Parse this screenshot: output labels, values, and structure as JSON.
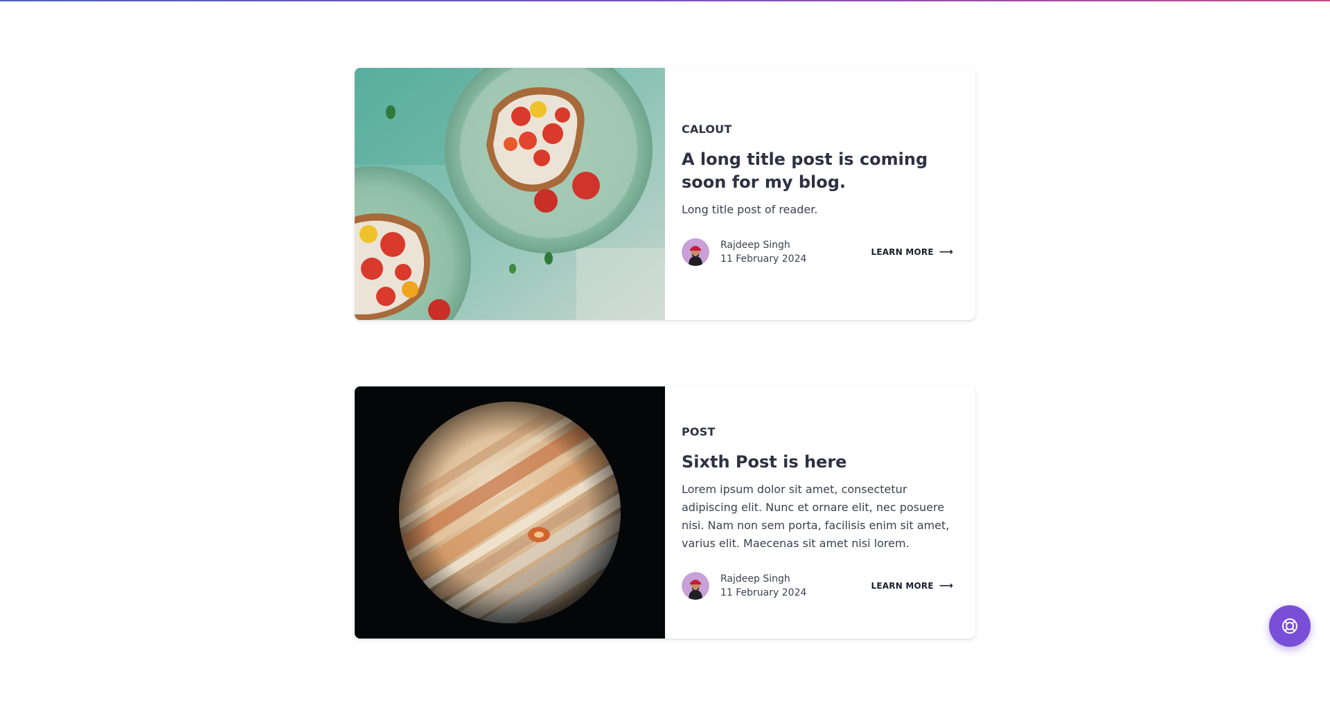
{
  "posts": [
    {
      "tag": "CALOUT",
      "title": "A long title post is coming soon for my blog.",
      "excerpt": "Long title post of reader.",
      "author": "Rajdeep Singh",
      "date": "11 February 2024",
      "cta": "LEARN MORE",
      "image_icon": "toast-tomato-plate-image"
    },
    {
      "tag": "POST",
      "title": "Sixth Post is here",
      "excerpt": "Lorem ipsum dolor sit amet, consectetur adipiscing elit. Nunc et ornare elit, nec posuere nisi. Nam non sem porta, facilisis enim sit amet, varius elit. Maecenas sit amet nisi lorem.",
      "author": "Rajdeep Singh",
      "date": "11 February 2024",
      "cta": "LEARN MORE",
      "image_icon": "jupiter-planet-image"
    }
  ],
  "colors": {
    "accent": "#7a4fd8",
    "text": "#2d3142",
    "progress_start": "#4a5fc1",
    "progress_end": "#c04a8a"
  },
  "help_button": {
    "icon": "help-lifebuoy-icon"
  }
}
